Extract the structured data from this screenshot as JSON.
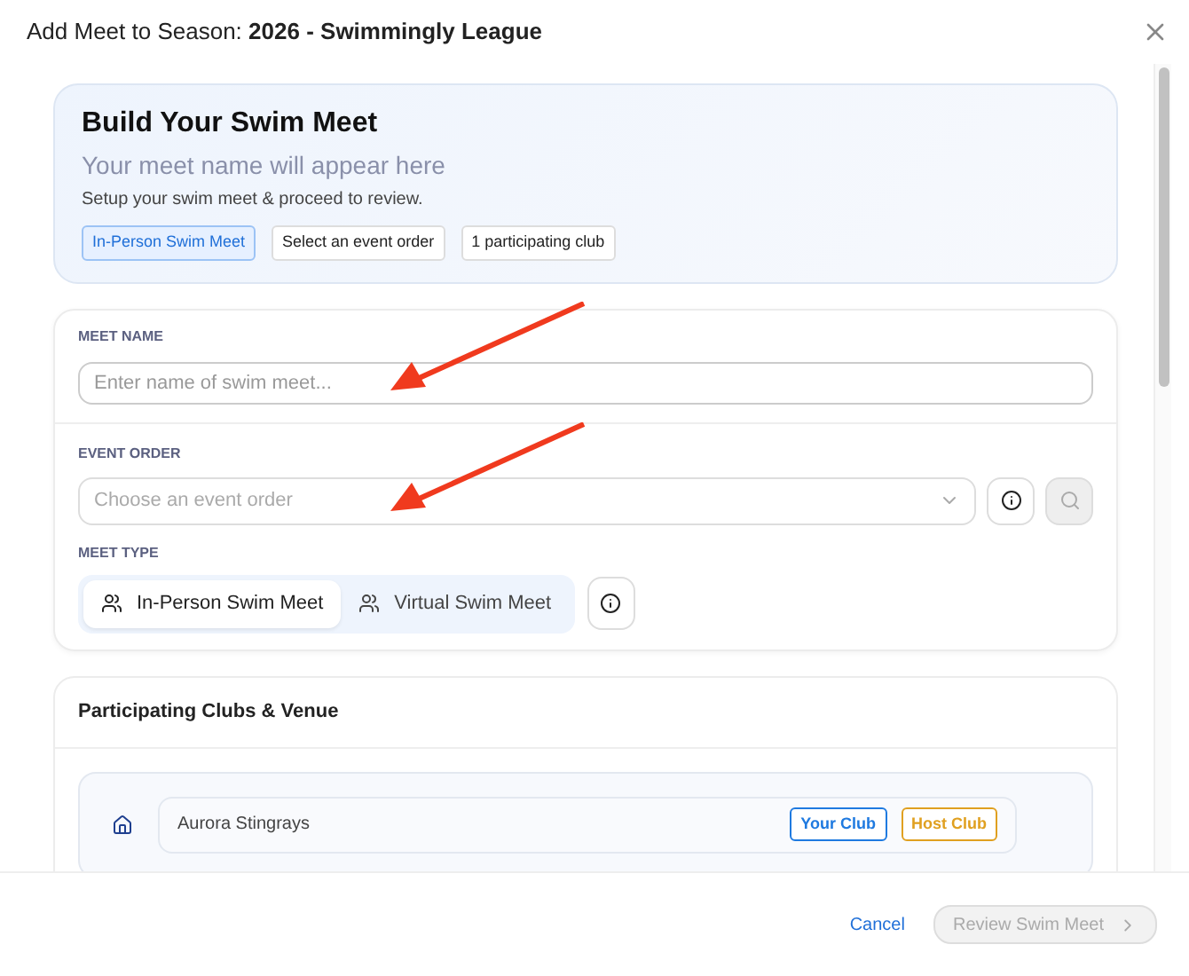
{
  "dialog": {
    "title_prefix": "Add Meet to Season:",
    "title_bold": "2026 - Swimmingly League"
  },
  "summary": {
    "heading": "Build Your Swim Meet",
    "meet_name": "Your meet name will appear here",
    "subtitle": "Setup your swim meet & proceed to review.",
    "badges": [
      {
        "label": "In-Person Swim Meet",
        "highlighted": true
      },
      {
        "label": "Select an event order",
        "highlighted": false
      },
      {
        "label": "1 participating club",
        "highlighted": false
      }
    ]
  },
  "meet_name": {
    "label": "MEET NAME",
    "placeholder": "Enter name of swim meet..."
  },
  "event_order": {
    "label": "EVENT ORDER",
    "placeholder": "Choose an event order",
    "search_disabled": true
  },
  "meet_type": {
    "label": "MEET TYPE",
    "options": [
      {
        "label": "In-Person Swim Meet",
        "selected": true
      },
      {
        "label": "Virtual Swim Meet",
        "selected": false
      }
    ]
  },
  "clubs": {
    "heading": "Participating Clubs & Venue",
    "rows": [
      {
        "name": "Aurora Stingrays",
        "tags": [
          {
            "label": "Your Club",
            "color": "#1f7ae0"
          },
          {
            "label": "Host Club",
            "color": "#e0a020"
          }
        ]
      }
    ]
  },
  "footer": {
    "cancel": "Cancel",
    "review": {
      "label": "Review Swim Meet",
      "disabled": true
    }
  }
}
